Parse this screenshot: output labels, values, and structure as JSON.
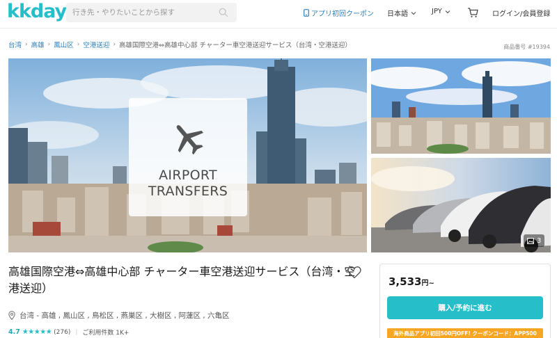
{
  "header": {
    "logo": "kkday",
    "search_placeholder": "行き先・やりたいことから探す",
    "app_coupon": "アプリ初回クーポン",
    "language": "日本語",
    "currency": "JPY",
    "login": "ログイン/会員登録"
  },
  "breadcrumb": {
    "items": [
      "台湾",
      "高雄",
      "鳳山区",
      "空港送迎"
    ],
    "current": "高雄国際空港⇔高雄中心部 チャーター車空港送迎サービス（台湾・空港送迎）"
  },
  "product_number": "商品番号 #19394",
  "gallery": {
    "overlay_line1": "AIRPORT",
    "overlay_line2": "TRANSFERS",
    "photo_count": "3"
  },
  "product": {
    "title": "高雄国際空港⇔高雄中心部 チャーター車空港送迎サービス（台湾・空港送迎）",
    "location": "台湾 - 高雄 , 鳳山区 , 鳥松区 , 燕巣区 , 大樹区 , 阿蓮区 , 六亀区",
    "rating": "4.7",
    "stars": "★★★★★",
    "review_count": "(276)",
    "users": "ご利用件数 1K+"
  },
  "booking": {
    "price": "3,533",
    "price_suffix": "円~",
    "book_label": "購入/予約に進む",
    "promo": "海外商品アプリ初回500円OFF! クーポンコード：APP500"
  },
  "colors": {
    "brand": "#26bec9",
    "link": "#2a7fb8",
    "promo": "#f6a623"
  }
}
